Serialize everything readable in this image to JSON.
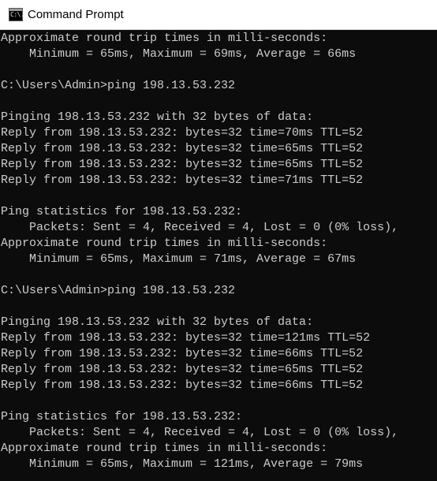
{
  "window": {
    "title": "Command Prompt",
    "icon": "cmd-console-icon",
    "icon_glyph": "C:\\."
  },
  "colors": {
    "background": "#0c0c0c",
    "text": "#cccccc",
    "titlebar": "#ffffff"
  },
  "console": {
    "lines": [
      "Approximate round trip times in milli-seconds:",
      "    Minimum = 65ms, Maximum = 69ms, Average = 66ms",
      "",
      "C:\\Users\\Admin>ping 198.13.53.232",
      "",
      "Pinging 198.13.53.232 with 32 bytes of data:",
      "Reply from 198.13.53.232: bytes=32 time=70ms TTL=52",
      "Reply from 198.13.53.232: bytes=32 time=65ms TTL=52",
      "Reply from 198.13.53.232: bytes=32 time=65ms TTL=52",
      "Reply from 198.13.53.232: bytes=32 time=71ms TTL=52",
      "",
      "Ping statistics for 198.13.53.232:",
      "    Packets: Sent = 4, Received = 4, Lost = 0 (0% loss),",
      "Approximate round trip times in milli-seconds:",
      "    Minimum = 65ms, Maximum = 71ms, Average = 67ms",
      "",
      "C:\\Users\\Admin>ping 198.13.53.232",
      "",
      "Pinging 198.13.53.232 with 32 bytes of data:",
      "Reply from 198.13.53.232: bytes=32 time=121ms TTL=52",
      "Reply from 198.13.53.232: bytes=32 time=66ms TTL=52",
      "Reply from 198.13.53.232: bytes=32 time=65ms TTL=52",
      "Reply from 198.13.53.232: bytes=32 time=66ms TTL=52",
      "",
      "Ping statistics for 198.13.53.232:",
      "    Packets: Sent = 4, Received = 4, Lost = 0 (0% loss),",
      "Approximate round trip times in milli-seconds:",
      "    Minimum = 65ms, Maximum = 121ms, Average = 79ms"
    ]
  }
}
